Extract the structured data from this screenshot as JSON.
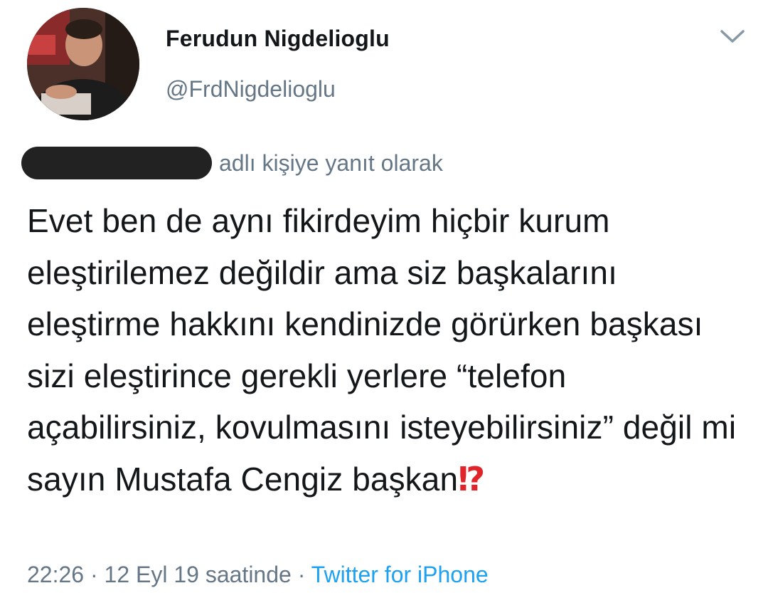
{
  "author": {
    "name": "Ferudun Nigdelioglu",
    "handle": "@FrdNigdelioglu",
    "avatar_icon": "profile-photo"
  },
  "reply_context": {
    "text": "adlı kişiye yanıt olarak",
    "redacted_username": true
  },
  "tweet": {
    "text": "Evet ben de aynı fikirdeyim hiçbir kurum eleştirilemez değildir ama siz başkalarını eleştirme hakkını kendinizde görürken başkası sizi eleştirince gerekli yerlere “telefon açabilirsiniz, kovulmasını isteyebilirsiniz” değil mi sayın Mustafa Cengiz başkan",
    "emoji": "⁉"
  },
  "meta": {
    "time": "22:26",
    "separator": "·",
    "date_text": "12 Eyl 19 saatinde",
    "source": "Twitter for iPhone"
  },
  "colors": {
    "text": "#14171a",
    "secondary": "#657786",
    "link": "#1da1f2",
    "emoji": "#e0242a"
  }
}
